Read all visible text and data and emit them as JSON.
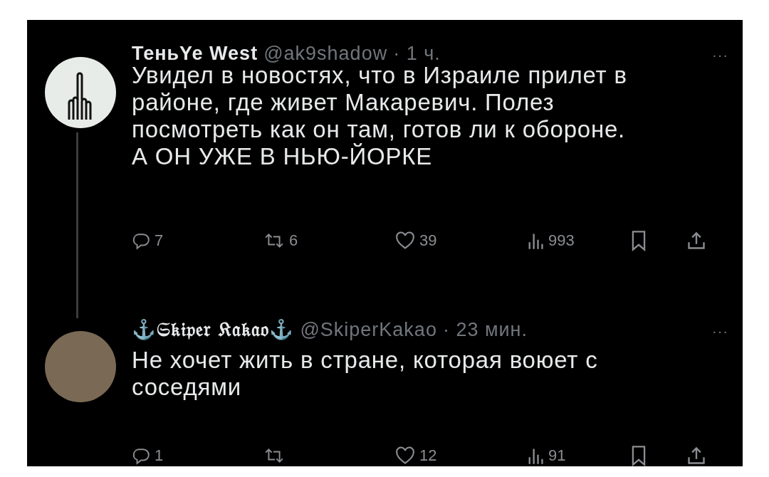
{
  "tweets": [
    {
      "avatar": {
        "kind": "hand"
      },
      "name": "ТеньYe West",
      "handle": "@ak9shadow",
      "time": "· 1 ч.",
      "more": "···",
      "thread_line": true,
      "lines": [
        "Увидел в новостях, что в Израиле прилет в",
        "районе, где живет Макаревич. Полез",
        "посмотреть как он там, готов ли к обороне.",
        "А ОН УЖЕ В НЬЮ-ЙОРКЕ"
      ],
      "actions": [
        {
          "kind": "reply",
          "count": "7"
        },
        {
          "kind": "retweet",
          "count": "6"
        },
        {
          "kind": "like",
          "count": "39"
        },
        {
          "kind": "views",
          "count": "993"
        },
        {
          "kind": "bookmark"
        },
        {
          "kind": "share"
        }
      ]
    },
    {
      "avatar": {
        "kind": "photo"
      },
      "name": "⚓𝔖𝔨𝔦𝔭𝔢𝔯 𝔎𝔞𝔨𝔞𝔬⚓",
      "handle": "@SkiperKakao",
      "time": "· 23 мин.",
      "more": "···",
      "thread_line": false,
      "lines": [
        "Не хочет жить в стране, которая воюет с",
        "соседями"
      ],
      "actions": [
        {
          "kind": "reply",
          "count": "1"
        },
        {
          "kind": "retweet"
        },
        {
          "kind": "like",
          "count": "12"
        },
        {
          "kind": "views",
          "count": "91"
        },
        {
          "kind": "bookmark"
        },
        {
          "kind": "share"
        }
      ]
    }
  ]
}
